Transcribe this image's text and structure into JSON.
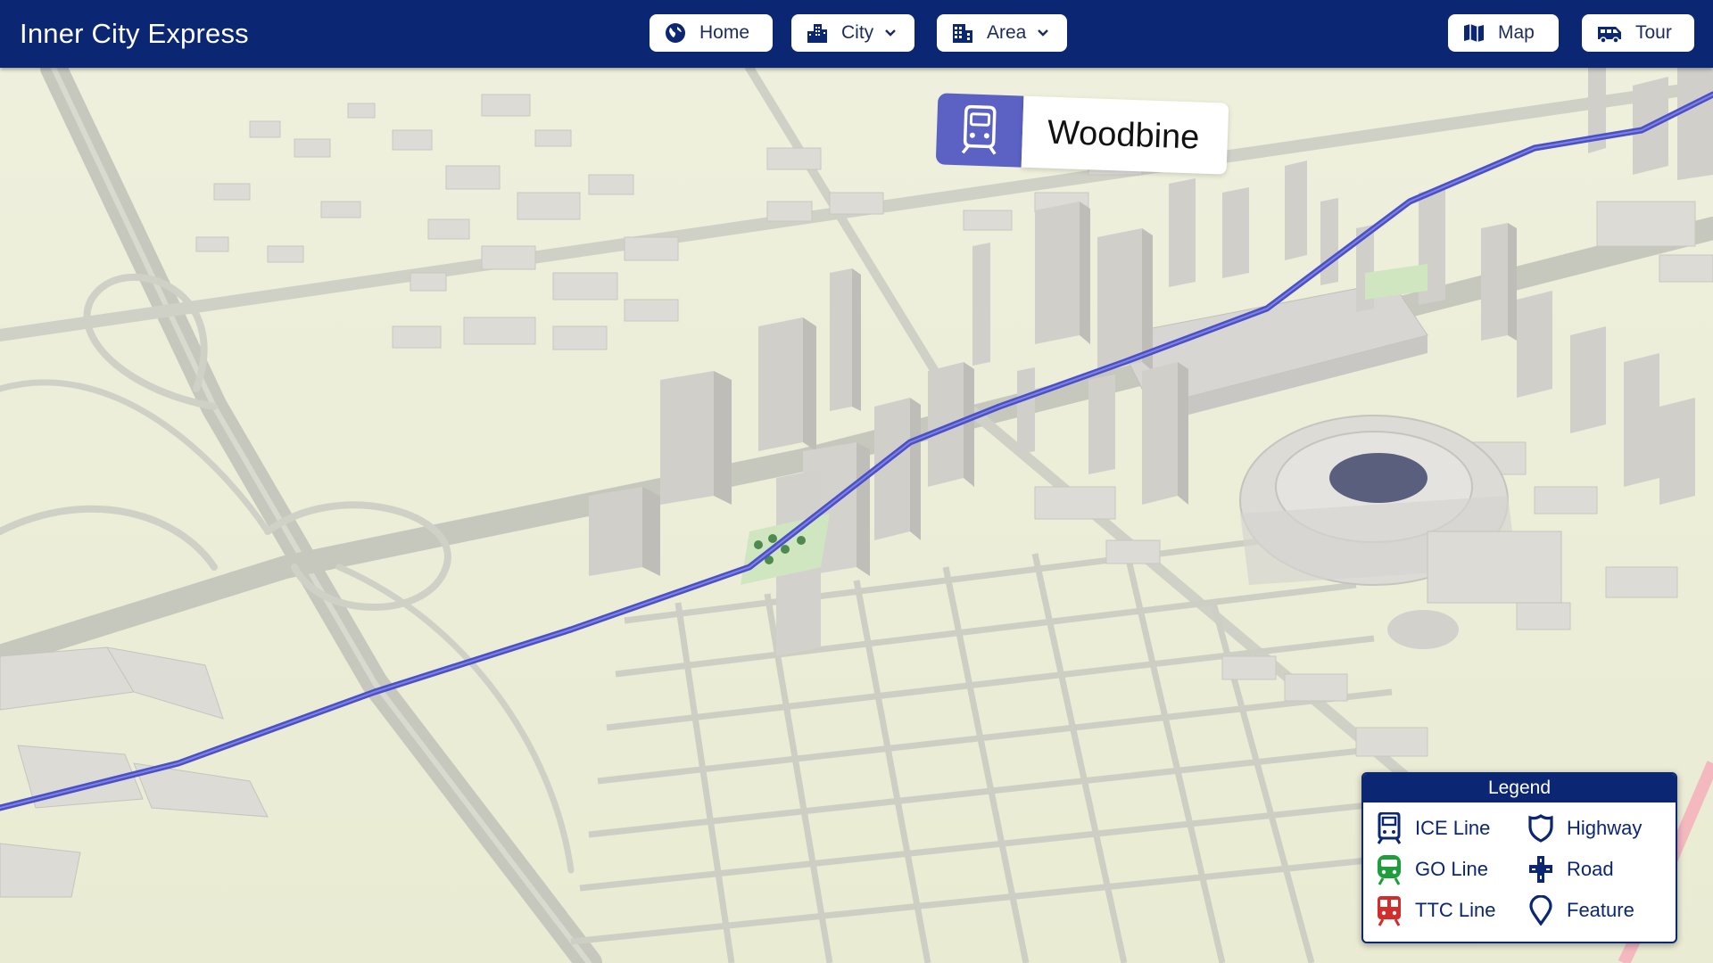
{
  "app": {
    "title": "Inner City Express"
  },
  "nav": {
    "home": {
      "label": "Home",
      "icon": "globe-icon"
    },
    "city": {
      "label": "City",
      "icon": "city-icon"
    },
    "area": {
      "label": "Area",
      "icon": "building-icon"
    },
    "map": {
      "label": "Map",
      "icon": "map-icon"
    },
    "tour": {
      "label": "Tour",
      "icon": "bus-icon"
    }
  },
  "station": {
    "name": "Woodbine",
    "icon": "tram-icon"
  },
  "legend": {
    "title": "Legend",
    "items": [
      {
        "label": "ICE Line",
        "icon": "tram-icon",
        "color": "#0b2672"
      },
      {
        "label": "Highway",
        "icon": "shield-icon",
        "color": "#0b2672"
      },
      {
        "label": "GO Line",
        "icon": "train-icon",
        "color": "#1e9e3a"
      },
      {
        "label": "Road",
        "icon": "road-cross-icon",
        "color": "#0b2672"
      },
      {
        "label": "TTC Line",
        "icon": "subway-icon",
        "color": "#d42b2b"
      },
      {
        "label": "Feature",
        "icon": "pin-icon",
        "color": "#0b2672"
      }
    ]
  },
  "colors": {
    "header": "#0b2672",
    "map_ground": "#ecedd8",
    "roads": "#c9cbc0",
    "buildings": "#dedcdc",
    "ice_line": "#4b4fc8",
    "station_badge": "#5b62c4"
  }
}
